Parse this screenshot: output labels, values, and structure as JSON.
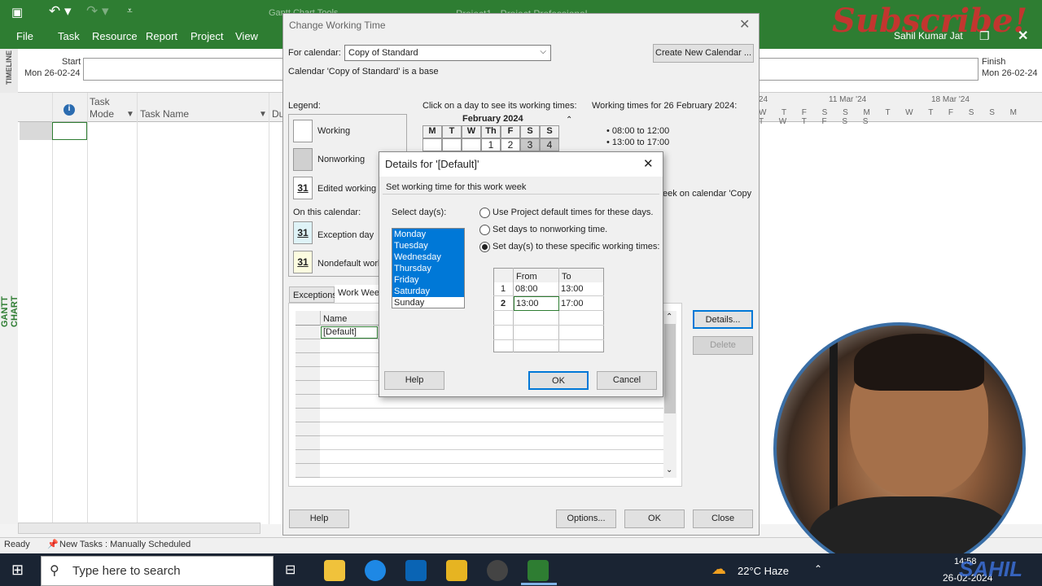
{
  "ribbon": {
    "menus": [
      "File",
      "Task",
      "Resource",
      "Report",
      "Project",
      "View"
    ],
    "tools_tab": "Gantt Chart Tools",
    "title": "Project1 - Project Professional",
    "user": "Sahil Kumar Jat",
    "overlay_text": "Subscribe!"
  },
  "timeline": {
    "label": "TIMELINE",
    "start_label": "Start",
    "start_date": "Mon 26-02-24",
    "finish_label": "Finish",
    "finish_date": "Mon 26-02-24"
  },
  "grid": {
    "info_icon": "info-icon",
    "col_task_mode": "Task Mode",
    "col_task_name": "Task Name",
    "col_duration": "Du",
    "week_labels": [
      "'24",
      "11 Mar '24",
      "18 Mar '24"
    ],
    "day_letters": "W T F S S M T W T F S S M T W T F S S",
    "side_label": "GANTT CHART"
  },
  "status": {
    "ready": "Ready",
    "new_tasks": "New Tasks : Manually Scheduled"
  },
  "change_working_time": {
    "title": "Change Working Time",
    "for_calendar_label": "For calendar:",
    "for_calendar_value": "Copy of Standard",
    "create_button": "Create New Calendar ...",
    "base_text": "Calendar 'Copy of Standard' is a base",
    "legend_label": "Legend:",
    "legend": {
      "working": "Working",
      "nonworking": "Nonworking",
      "edited": "Edited working h",
      "on_this_calendar": "On this calendar:",
      "exception": "Exception day",
      "nondefault": "Nondefault work",
      "day_number": "31"
    },
    "click_text": "Click on a day to see its working times:",
    "month": "February 2024",
    "weekdays": [
      "M",
      "T",
      "W",
      "Th",
      "F",
      "S",
      "S"
    ],
    "first_row": [
      "",
      "",
      "",
      "1",
      "2",
      "3",
      "4"
    ],
    "times_header": "Working times for 26 February 2024:",
    "times": [
      "• 08:00 to 12:00",
      "• 13:00 to 17:00"
    ],
    "week_text": "eek on calendar 'Copy",
    "tabs": [
      "Exceptions",
      "Work Weeks"
    ],
    "table_header": "Name",
    "table_first": "[Default]",
    "details_button": "Details...",
    "delete_button": "Delete",
    "help_button": "Help",
    "options_button": "Options...",
    "ok_button": "OK",
    "close_button": "Close"
  },
  "details": {
    "title": "Details for '[Default]'",
    "subtitle": "Set working time for this work week",
    "select_days_label": "Select day(s):",
    "days": [
      "Monday",
      "Tuesday",
      "Wednesday",
      "Thursday",
      "Friday",
      "Saturday",
      "Sunday"
    ],
    "radio_default": "Use Project default times for these days.",
    "radio_nonworking": "Set days to nonworking time.",
    "radio_specific": "Set day(s) to these specific working times:",
    "col_from": "From",
    "col_to": "To",
    "rows": [
      {
        "n": "1",
        "from": "08:00",
        "to": "13:00"
      },
      {
        "n": "2",
        "from": "13:00",
        "to": "17:00"
      }
    ],
    "help_button": "Help",
    "ok_button": "OK",
    "cancel_button": "Cancel"
  },
  "taskbar": {
    "search_placeholder": "Type here to search",
    "weather": "22°C  Haze",
    "time": "14:58",
    "date": "26-02-2024",
    "watermark": "SAHIL"
  }
}
